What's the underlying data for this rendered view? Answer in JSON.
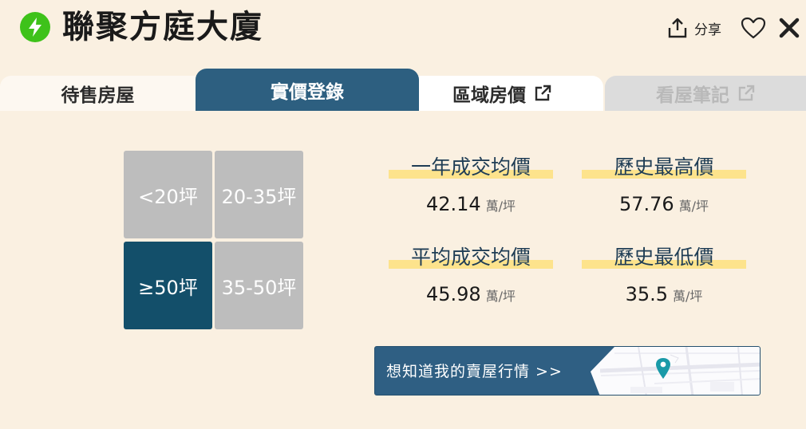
{
  "header": {
    "title": "聯聚方庭大廈",
    "share_label": "分享"
  },
  "icons": {
    "bolt": "lightning-bolt-icon",
    "share": "share-upload-icon",
    "favorite": "heart-icon",
    "close": "close-icon",
    "external": "external-link-icon",
    "map_pin": "map-pin-icon"
  },
  "tabs": [
    {
      "label": "待售房屋",
      "active": false,
      "external": false,
      "disabled": false
    },
    {
      "label": "實價登錄",
      "active": true,
      "external": false,
      "disabled": false
    },
    {
      "label": "區域房價",
      "active": false,
      "external": true,
      "disabled": false
    },
    {
      "label": "看屋筆記",
      "active": false,
      "external": true,
      "disabled": true
    }
  ],
  "size_filters": [
    {
      "label": "<20坪",
      "selected": false
    },
    {
      "label": "20-35坪",
      "selected": false
    },
    {
      "label": "≥50坪",
      "selected": true
    },
    {
      "label": "35-50坪",
      "selected": false
    }
  ],
  "stats": [
    {
      "label": "一年成交均價",
      "value": "42.14",
      "unit": "萬/坪"
    },
    {
      "label": "歷史最高價",
      "value": "57.76",
      "unit": "萬/坪"
    },
    {
      "label": "平均成交均價",
      "value": "45.98",
      "unit": "萬/坪"
    },
    {
      "label": "歷史最低價",
      "value": "35.5",
      "unit": "萬/坪"
    }
  ],
  "cta": {
    "label": "想知道我的賣屋行情 >>"
  },
  "colors": {
    "background": "#faf0e1",
    "active_tab": "#2d5f80",
    "selected_filter": "#134f6a",
    "filter": "#bdbdbd",
    "highlight": "#fde38c",
    "bolt": "#3ec21a",
    "map_pin": "#1a9aa8"
  }
}
